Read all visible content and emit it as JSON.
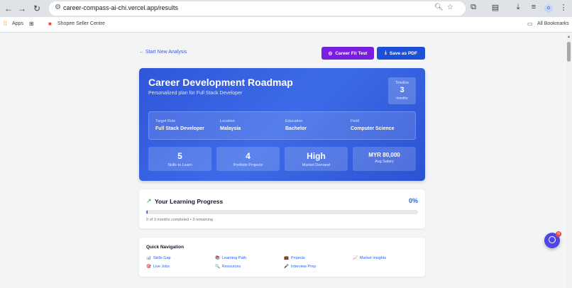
{
  "browser": {
    "url": "career-compass-ai-chi.vercel.app/results",
    "profile_initial": "o",
    "bookmarks": {
      "apps": "Apps",
      "shopee": "Shopee Seller Centre",
      "all": "All Bookmarks"
    }
  },
  "page": {
    "back_link": "← Start New Analysis",
    "career_fit_button": "Career Fit Test",
    "save_pdf_button": "Save as PDF"
  },
  "hero": {
    "title": "Career Development Roadmap",
    "subtitle": "Personalized plan for Full Stack Developer",
    "timeline": {
      "label": "Timeline",
      "value": "3",
      "unit": "months"
    },
    "info": [
      {
        "label": "Target Role",
        "value": "Full Stack Developer"
      },
      {
        "label": "Location",
        "value": "Malaysia"
      },
      {
        "label": "Education",
        "value": "Bachelor"
      },
      {
        "label": "Field",
        "value": "Computer Science"
      }
    ],
    "stats": [
      {
        "value": "5",
        "label": "Skills to Learn"
      },
      {
        "value": "4",
        "label": "Portfolio Projects"
      },
      {
        "value": "High",
        "label": "Market Demand"
      },
      {
        "value": "MYR 80,000",
        "label": "Avg Salary"
      }
    ]
  },
  "progress": {
    "title": "Your Learning Progress",
    "percent_label": "0%",
    "percent": 0,
    "caption": "0 of 3 months completed • 3 remaining"
  },
  "quick_nav": {
    "title": "Quick Navigation",
    "links": [
      {
        "icon": "📊",
        "label": "Skills Gap"
      },
      {
        "icon": "📚",
        "label": "Learning Path"
      },
      {
        "icon": "💼",
        "label": "Projects"
      },
      {
        "icon": "📈",
        "label": "Market Insights"
      },
      {
        "icon": "🎯",
        "label": "Live Jobs"
      },
      {
        "icon": "🔍",
        "label": "Resources"
      },
      {
        "icon": "🎤",
        "label": "Interview Prep"
      }
    ]
  },
  "chat": {
    "badge": "N"
  },
  "colors": {
    "hero_start": "#2f56d9",
    "career_fit": "#7a1fe0",
    "save_pdf": "#1d4fd8",
    "accent": "#2563eb"
  }
}
